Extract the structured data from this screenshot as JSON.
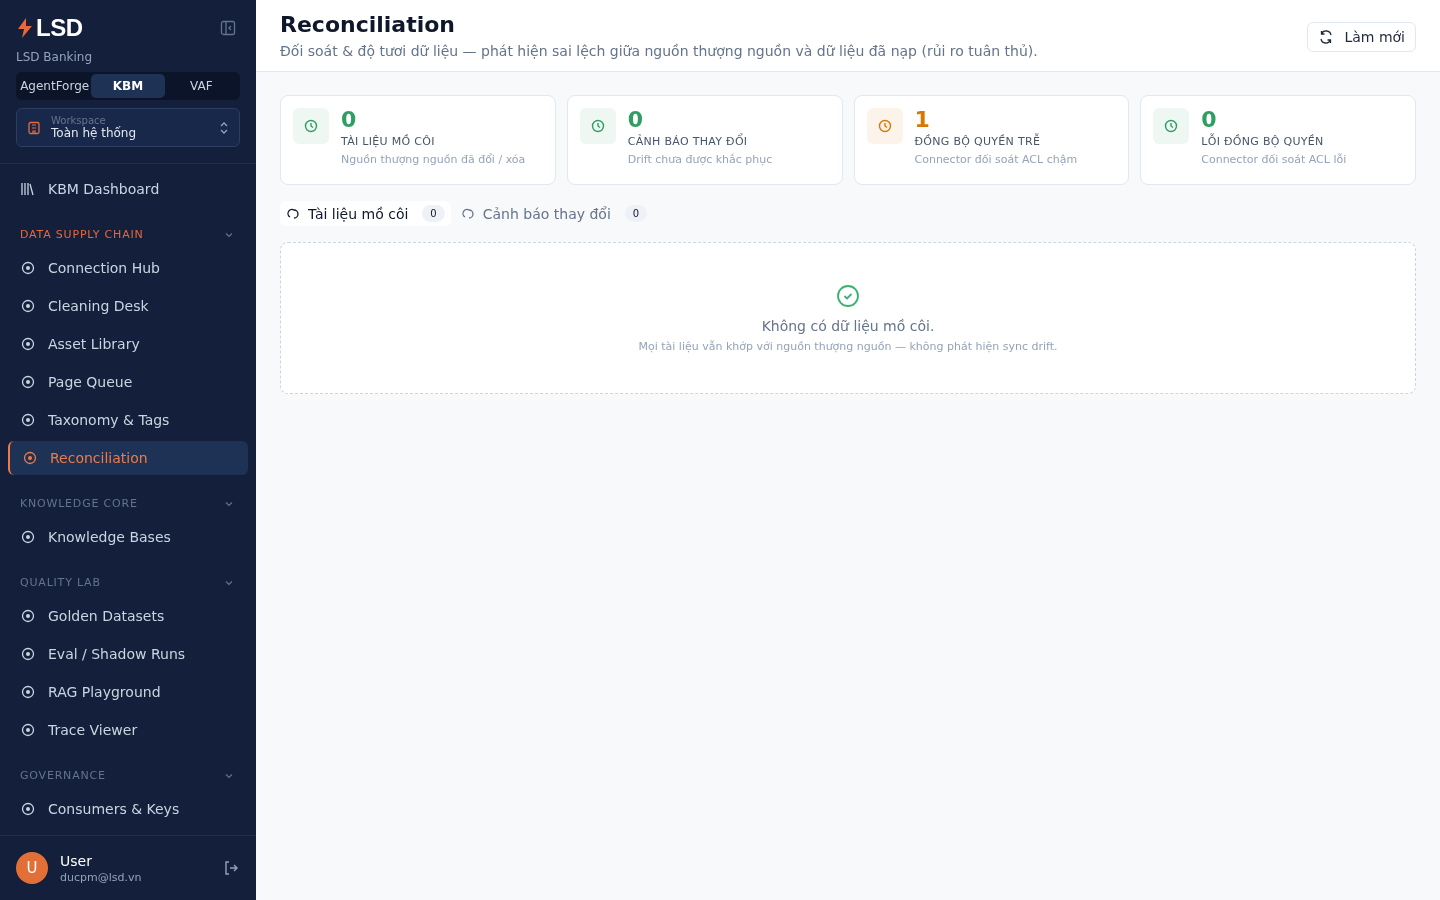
{
  "sidebar": {
    "brand": "LSD",
    "org": "LSD Banking",
    "products": [
      {
        "label": "AgentForge",
        "selected": false
      },
      {
        "label": "KBM",
        "selected": true
      },
      {
        "label": "VAF",
        "selected": false
      }
    ],
    "workspace": {
      "label": "Workspace",
      "value": "Toàn hệ thống"
    },
    "top_items": [
      {
        "label": "KBM Dashboard",
        "selected": false
      }
    ],
    "sections": [
      {
        "title": "DATA SUPPLY CHAIN",
        "active": true,
        "expanded": true,
        "items": [
          {
            "label": "Connection Hub",
            "selected": false
          },
          {
            "label": "Cleaning Desk",
            "selected": false
          },
          {
            "label": "Asset Library",
            "selected": false
          },
          {
            "label": "Page Queue",
            "selected": false
          },
          {
            "label": "Taxonomy & Tags",
            "selected": false
          },
          {
            "label": "Reconciliation",
            "selected": true
          }
        ]
      },
      {
        "title": "KNOWLEDGE CORE",
        "active": false,
        "expanded": true,
        "items": [
          {
            "label": "Knowledge Bases",
            "selected": false
          }
        ]
      },
      {
        "title": "QUALITY LAB",
        "active": false,
        "expanded": true,
        "items": [
          {
            "label": "Golden Datasets",
            "selected": false
          },
          {
            "label": "Eval / Shadow Runs",
            "selected": false
          },
          {
            "label": "RAG Playground",
            "selected": false
          },
          {
            "label": "Trace Viewer",
            "selected": false
          }
        ]
      },
      {
        "title": "GOVERNANCE",
        "active": false,
        "expanded": true,
        "items": [
          {
            "label": "Consumers & Keys",
            "selected": false
          }
        ]
      }
    ],
    "user": {
      "initial": "U",
      "name": "User",
      "email": "ducpm@lsd.vn"
    }
  },
  "header": {
    "title": "Reconciliation",
    "subtitle": "Đối soát & độ tươi dữ liệu — phát hiện sai lệch giữa nguồn thượng nguồn và dữ liệu đã nạp (rủi ro tuân thủ).",
    "refresh": "Làm mới"
  },
  "stats": [
    {
      "value": "0",
      "label": "TÀI LIỆU MỒ CÔI",
      "hint": "Nguồn thượng nguồn đã đổi / xóa",
      "color": "#2f9e63"
    },
    {
      "value": "0",
      "label": "CẢNH BÁO THAY ĐỔI",
      "hint": "Drift chưa được khắc phục",
      "color": "#2f9e63"
    },
    {
      "value": "1",
      "label": "ĐỒNG BỘ QUYỀN TRỄ",
      "hint": "Connector đối soát ACL chậm",
      "color": "#d97706"
    },
    {
      "value": "0",
      "label": "LỖI ĐỒNG BỘ QUYỀN",
      "hint": "Connector đối soát ACL lỗi",
      "color": "#2f9e63"
    }
  ],
  "tabs": [
    {
      "label": "Tài liệu mồ côi",
      "count": "0",
      "selected": true
    },
    {
      "label": "Cảnh báo thay đổi",
      "count": "0",
      "selected": false
    }
  ],
  "empty": {
    "title": "Không có dữ liệu mồ côi.",
    "text": "Mọi tài liệu vẫn khớp với nguồn thượng nguồn — không phát hiện sync drift."
  }
}
